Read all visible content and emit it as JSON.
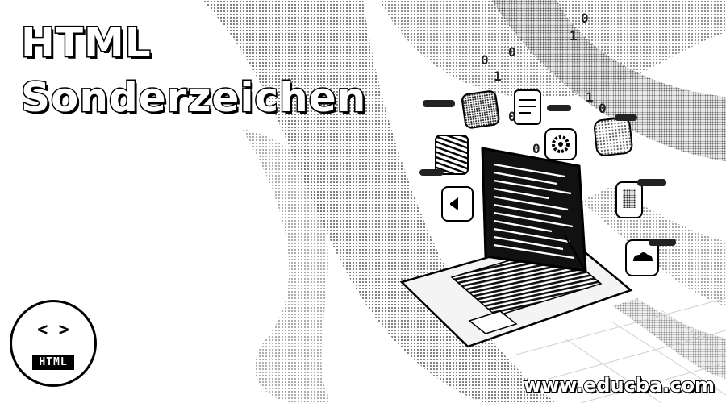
{
  "banner": {
    "title_line_1": "HTML",
    "title_line_2": "Sonderzeichen",
    "site_url": "www.educba.com"
  },
  "badge": {
    "code_symbol": "< >",
    "label": "HTML"
  },
  "icons": [
    "html-badge-icon",
    "laptop-icon",
    "code-lines",
    "document-icon",
    "gear-icon",
    "megaphone-icon",
    "chat-icon",
    "binary-digits"
  ],
  "colors": {
    "background": "#ffffff",
    "ink": "#000000",
    "halftone": "#9a9a9a"
  }
}
